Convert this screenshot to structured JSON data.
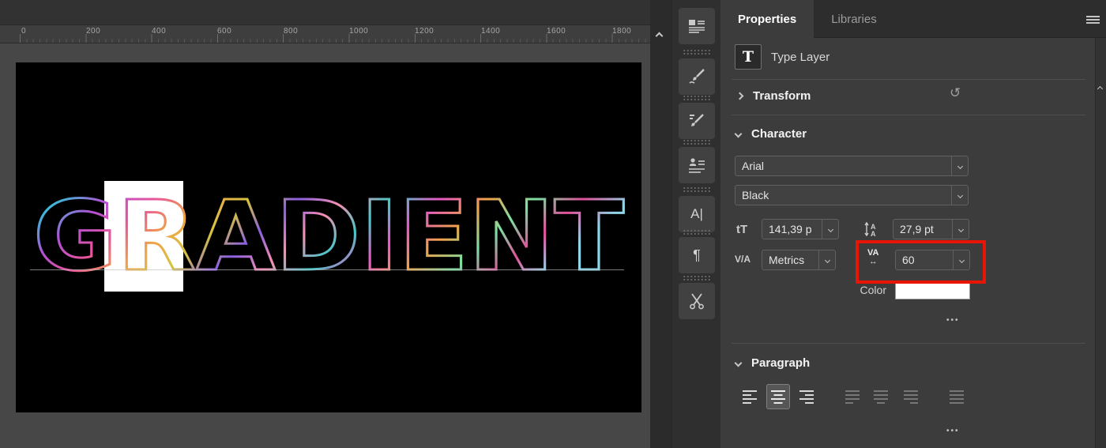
{
  "document": {
    "ruler_ticks": [
      "0",
      "200",
      "400",
      "600",
      "800",
      "1000",
      "1200",
      "1400",
      "1600",
      "1800"
    ],
    "canvas_text": "GRADIENT"
  },
  "gradient_stops": [
    "#6fdc9f",
    "#3fb6d8",
    "#b44fd6",
    "#e8559a",
    "#f0a24a",
    "#d6c43f",
    "#8a5fe0",
    "#f78fb3",
    "#44c8c8",
    "#e857c5",
    "#f0a24a",
    "#7be0a2",
    "#e0509a",
    "#8fd7e8"
  ],
  "dock": {
    "character_glyph": "A|",
    "paragraph_glyph": "¶"
  },
  "panel": {
    "tabs": {
      "properties": "Properties",
      "libraries": "Libraries"
    },
    "layer": {
      "icon": "T",
      "label": "Type Layer"
    },
    "transform": {
      "label": "Transform"
    },
    "character": {
      "label": "Character",
      "font_family": "Arial",
      "font_style": "Black",
      "size_icon": "tT",
      "size_value": "141,39 p",
      "leading_value": "27,9 pt",
      "kerning_icon": "V/A",
      "kerning_value": "Metrics",
      "tracking_icon": "VA",
      "tracking_arrow": "↔",
      "tracking_value": "60",
      "color_label": "Color",
      "more": "•••"
    },
    "paragraph": {
      "label": "Paragraph",
      "more": "•••"
    }
  },
  "colors": {
    "highlight_red": "#e81506",
    "color_swatch": "#ffffff"
  }
}
